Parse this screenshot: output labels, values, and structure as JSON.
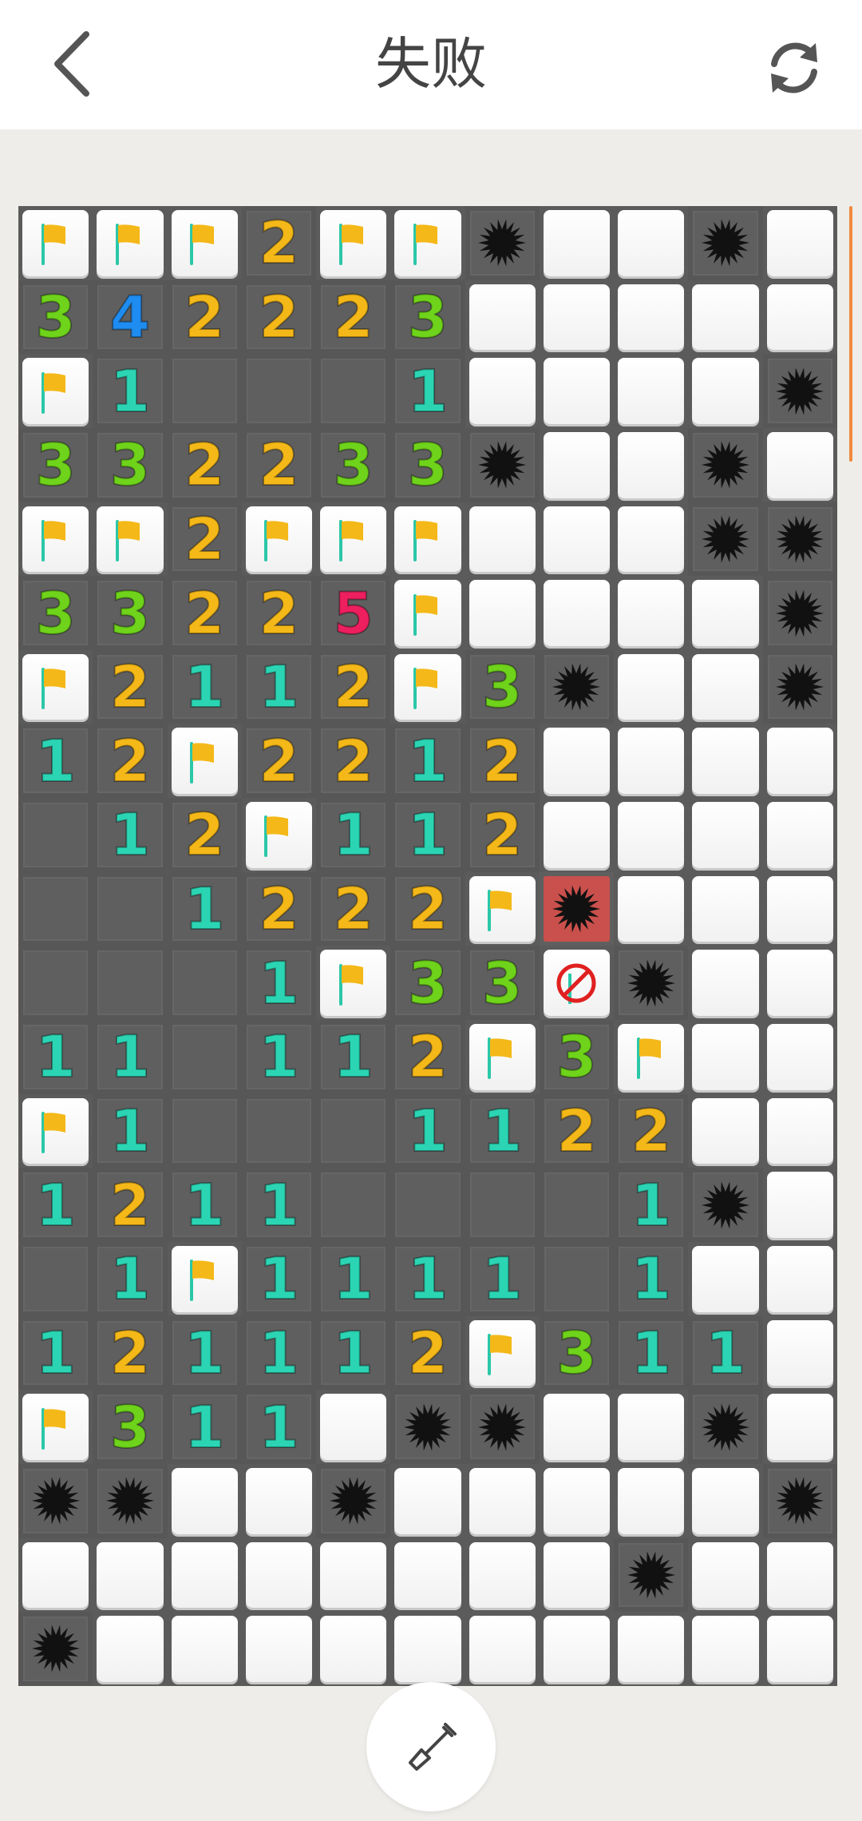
{
  "header": {
    "title": "失败",
    "back_icon": "chevron-left-icon",
    "refresh_icon": "refresh-icon"
  },
  "board": {
    "cols": 11,
    "rows": [
      "FFF2FFM..M.",
      "342223.....",
      "F1eee1....M",
      "332233M..M.",
      "FF2FFF...MM",
      "33225F....M",
      "F2112F3M..M",
      "12F2212....",
      "e12F112....",
      "ee1222FX...",
      "eee1F33WM..",
      "11e112F3F..",
      "F1eee1122..",
      "1211eeee1M.",
      "e1F1111e1..",
      "121112F311.",
      "F311.MM..M.",
      "MM..M.....M",
      "........M..",
      "M.........."
    ],
    "legend": {
      ".": "unopened",
      "F": "flag",
      "M": "mine",
      "X": "exploded-mine",
      "W": "wrong-flag",
      "e": "empty",
      "1-8": "number"
    },
    "colors": {
      "n1": "#2bd5b4",
      "n2": "#f4b818",
      "n3": "#6ed31a",
      "n4": "#1e8cf0",
      "n5": "#ee1f5f",
      "flag": "#f4b818",
      "mine": "#111111",
      "exploded_bg": "#c9504c",
      "wrong_mark": "#e02020"
    }
  },
  "footer": {
    "dig_icon": "shovel-icon"
  }
}
